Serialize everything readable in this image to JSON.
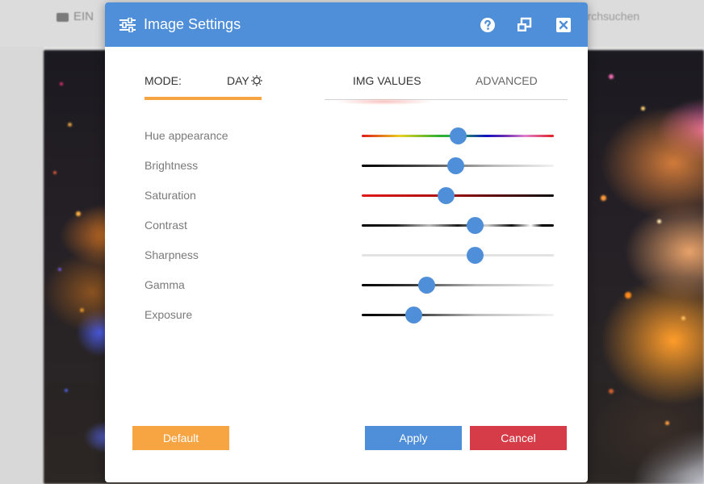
{
  "background": {
    "toolbar_label": "EIN",
    "search_text": "durchsuchen"
  },
  "dialog": {
    "title": "Image Settings",
    "icons": {
      "title": "sliders-icon",
      "help": "help-icon",
      "restore": "restore-window-icon",
      "close": "close-icon",
      "mode": "sun-icon"
    }
  },
  "mode": {
    "label": "MODE:",
    "value": "DAY"
  },
  "tabs": [
    {
      "label": "IMG VALUES",
      "active": true
    },
    {
      "label": "ADVANCED",
      "active": false
    }
  ],
  "sliders": [
    {
      "label": "Hue appearance",
      "value": 0.5
    },
    {
      "label": "Brightness",
      "value": 0.49
    },
    {
      "label": "Saturation",
      "value": 0.44
    },
    {
      "label": "Contrast",
      "value": 0.59
    },
    {
      "label": "Sharpness",
      "value": 0.59
    },
    {
      "label": "Gamma",
      "value": 0.34
    },
    {
      "label": "Exposure",
      "value": 0.27
    }
  ],
  "buttons": {
    "default": "Default",
    "apply": "Apply",
    "cancel": "Cancel"
  },
  "colors": {
    "primary": "#4f8fd9",
    "accent": "#f7a443",
    "danger": "#d63c48"
  }
}
